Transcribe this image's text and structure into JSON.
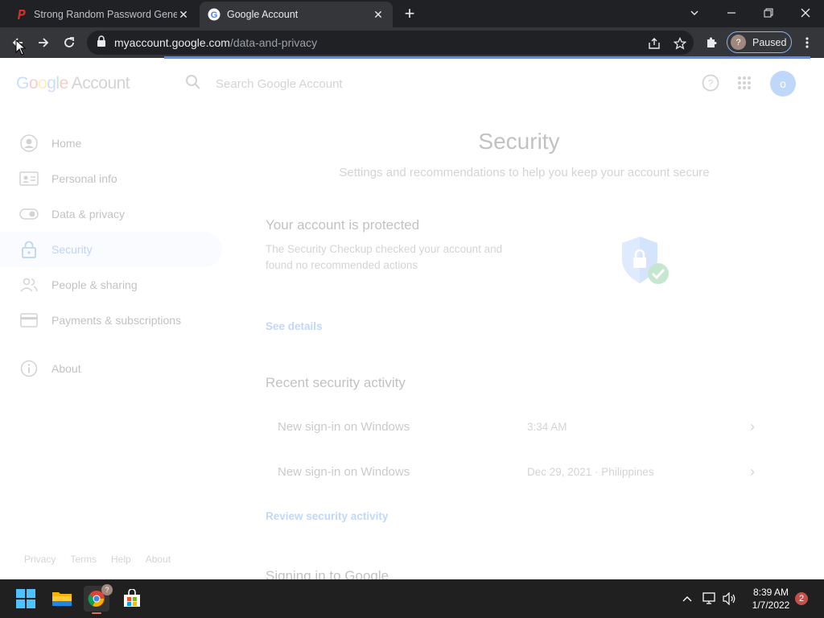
{
  "browser": {
    "tabs": [
      {
        "title": "Strong Random Password Genera",
        "icon": "password-generator-icon"
      },
      {
        "title": "Google Account",
        "icon": "google-g-icon",
        "active": true
      }
    ],
    "url_host": "myaccount.google.com",
    "url_path": "/data-and-privacy",
    "profile_label": "Paused",
    "profile_initial": "?"
  },
  "header": {
    "logo_google": "Google",
    "logo_account": "Account",
    "search_placeholder": "Search Google Account",
    "avatar_initial": "o"
  },
  "sidenav": {
    "items": [
      {
        "label": "Home",
        "icon": "home-icon"
      },
      {
        "label": "Personal info",
        "icon": "id-card-icon"
      },
      {
        "label": "Data & privacy",
        "icon": "toggle-icon"
      },
      {
        "label": "Security",
        "icon": "lock-icon",
        "active": true
      },
      {
        "label": "People & sharing",
        "icon": "people-icon"
      },
      {
        "label": "Payments & subscriptions",
        "icon": "credit-card-icon"
      },
      {
        "label": "About",
        "icon": "info-icon"
      }
    ],
    "footer": [
      "Privacy",
      "Terms",
      "Help",
      "About"
    ]
  },
  "main": {
    "title": "Security",
    "subtitle": "Settings and recommendations to help you keep your account secure",
    "protected_card": {
      "title": "Your account is protected",
      "description": "The Security Checkup checked your account and found no recommended actions",
      "link": "See details"
    },
    "recent": {
      "title": "Recent security activity",
      "rows": [
        {
          "title": "New sign-in on Windows",
          "detail": "3:34 AM"
        },
        {
          "title": "New sign-in on Windows",
          "detail": "Dec 29, 2021 · Philippines"
        }
      ],
      "link": "Review security activity"
    },
    "signing_in_title": "Signing in to Google"
  },
  "taskbar": {
    "time": "8:39 AM",
    "date": "1/7/2022",
    "notifications": "2",
    "chrome_badge": "?"
  }
}
